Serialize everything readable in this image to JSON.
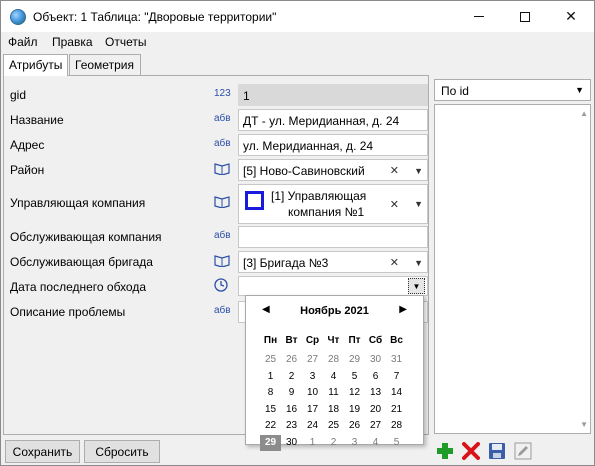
{
  "window": {
    "title": "Объект: 1 Таблица: \"Дворовые территории\"",
    "controls": {
      "minimize": "—",
      "maximize": "□",
      "close": "✕"
    }
  },
  "menu": [
    "Файл",
    "Правка",
    "Отчеты"
  ],
  "tabs": [
    "Атрибуты",
    "Геометрия"
  ],
  "attributes": {
    "gid": {
      "label": "gid",
      "type": "123",
      "value": "1"
    },
    "name": {
      "label": "Название",
      "type": "абв",
      "value": "ДТ - ул. Меридианная, д. 24"
    },
    "address": {
      "label": "Адрес",
      "type": "абв",
      "value": "ул. Меридианная, д. 24"
    },
    "district": {
      "label": "Район",
      "value": "[5]  Ново-Савиновский"
    },
    "management": {
      "label": "Управляющая компания",
      "value_line1": "[1]  Управляющая",
      "value_line2": "компания №1"
    },
    "service_company": {
      "label": "Обслуживающая компания",
      "type": "абв",
      "value": ""
    },
    "service_brigade": {
      "label": "Обслуживающая бригада",
      "value": "[3]  Бригада №3"
    },
    "last_check": {
      "label": "Дата последнего обхода",
      "value": ""
    },
    "problem": {
      "label": "Описание проблемы",
      "type": "абв",
      "value": ""
    }
  },
  "calendar": {
    "month": "Ноябрь 2021",
    "weekdays": [
      "Пн",
      "Вт",
      "Ср",
      "Чт",
      "Пт",
      "Сб",
      "Вс"
    ],
    "weeks": [
      [
        "25",
        "26",
        "27",
        "28",
        "29",
        "30",
        "31"
      ],
      [
        "1",
        "2",
        "3",
        "4",
        "5",
        "6",
        "7"
      ],
      [
        "8",
        "9",
        "10",
        "11",
        "12",
        "13",
        "14"
      ],
      [
        "15",
        "16",
        "17",
        "18",
        "19",
        "20",
        "21"
      ],
      [
        "22",
        "23",
        "24",
        "25",
        "26",
        "27",
        "28"
      ],
      [
        "29",
        "30",
        "1",
        "2",
        "3",
        "4",
        "5"
      ]
    ],
    "today": "29"
  },
  "sort": {
    "value": "По id"
  },
  "buttons": {
    "save": "Сохранить",
    "reset": "Сбросить"
  },
  "toolbar_icons": [
    "add-icon",
    "delete-icon",
    "save-disk-icon",
    "edit-pencil-icon"
  ],
  "colors": {
    "checkbox_border": "#1a1adc",
    "type_icon": "#2b4fa8",
    "add": "#1f9b2a",
    "delete": "#d8141a"
  }
}
